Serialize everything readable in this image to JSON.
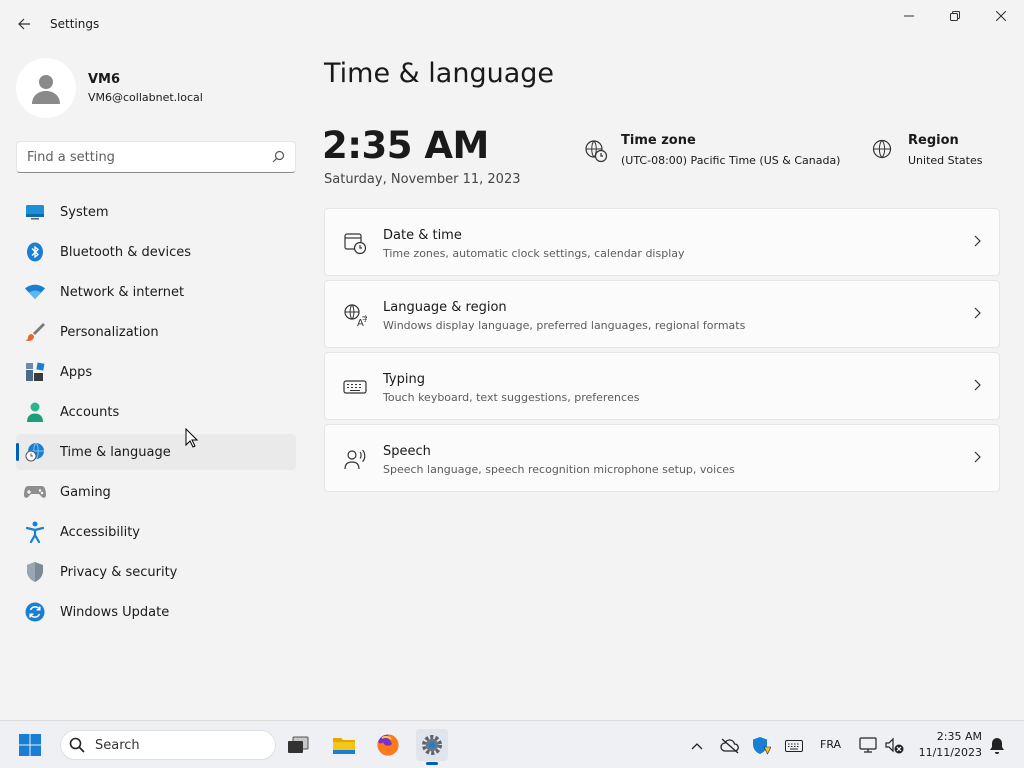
{
  "window": {
    "title": "Settings"
  },
  "profile": {
    "name": "VM6",
    "email": "VM6@collabnet.local"
  },
  "search": {
    "placeholder": "Find a setting"
  },
  "nav": {
    "items": [
      {
        "label": "System",
        "icon": "monitor-icon"
      },
      {
        "label": "Bluetooth & devices",
        "icon": "bluetooth-icon"
      },
      {
        "label": "Network & internet",
        "icon": "wifi-icon"
      },
      {
        "label": "Personalization",
        "icon": "paintbrush-icon"
      },
      {
        "label": "Apps",
        "icon": "apps-icon"
      },
      {
        "label": "Accounts",
        "icon": "person-icon"
      },
      {
        "label": "Time & language",
        "icon": "globe-clock-icon",
        "active": true
      },
      {
        "label": "Gaming",
        "icon": "gamepad-icon"
      },
      {
        "label": "Accessibility",
        "icon": "accessibility-icon"
      },
      {
        "label": "Privacy & security",
        "icon": "shield-icon"
      },
      {
        "label": "Windows Update",
        "icon": "refresh-icon"
      }
    ]
  },
  "main": {
    "title": "Time & language",
    "time": "2:35 AM",
    "date": "Saturday, November 11, 2023",
    "timezone": {
      "title": "Time zone",
      "value": "(UTC-08:00) Pacific Time (US & Canada)"
    },
    "region": {
      "title": "Region",
      "value": "United States"
    },
    "cards": [
      {
        "title": "Date & time",
        "subtitle": "Time zones, automatic clock settings, calendar display",
        "icon": "calendar-clock-icon"
      },
      {
        "title": "Language & region",
        "subtitle": "Windows display language, preferred languages, regional formats",
        "icon": "language-icon"
      },
      {
        "title": "Typing",
        "subtitle": "Touch keyboard, text suggestions, preferences",
        "icon": "keyboard-icon"
      },
      {
        "title": "Speech",
        "subtitle": "Speech language, speech recognition microphone setup, voices",
        "icon": "speech-icon"
      }
    ]
  },
  "taskbar": {
    "search_label": "Search",
    "lang": "FRA",
    "clock_time": "2:35 AM",
    "clock_date": "11/11/2023"
  },
  "colors": {
    "accent": "#005fb8",
    "background": "#f3f3f3",
    "card": "#fbfbfb"
  }
}
